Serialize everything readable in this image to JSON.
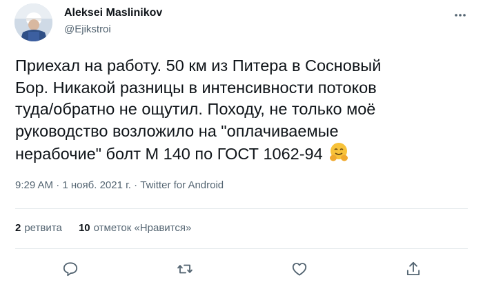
{
  "author": {
    "name": "Aleksei Maslinikov",
    "handle": "@Ejikstroi"
  },
  "tweet": {
    "text": "Приехал на работу. 50 км из Питера в Сосновый\nБор. Никакой разницы в интенсивности потоков\nтуда/обратно не ощутил. Походу, не только моё\nруководство возложило на \"оплачиваемые\nнерабочие\" болт М 140 по ГОСТ 1062-94",
    "emoji": "hugging-face"
  },
  "meta": {
    "time": "9:29 AM",
    "separator": "·",
    "date": "1 нояб. 2021 г.",
    "source": "Twitter for Android"
  },
  "stats": {
    "retweets_count": "2",
    "retweets_label": "ретвита",
    "likes_count": "10",
    "likes_label": "отметок «Нравится»"
  },
  "actions": [
    "reply-icon",
    "retweet-icon",
    "like-icon",
    "share-icon"
  ],
  "colors": {
    "text": "#0f1419",
    "secondary": "#536471",
    "divider": "#e4e9ec",
    "emoji": "#f7c23a"
  }
}
